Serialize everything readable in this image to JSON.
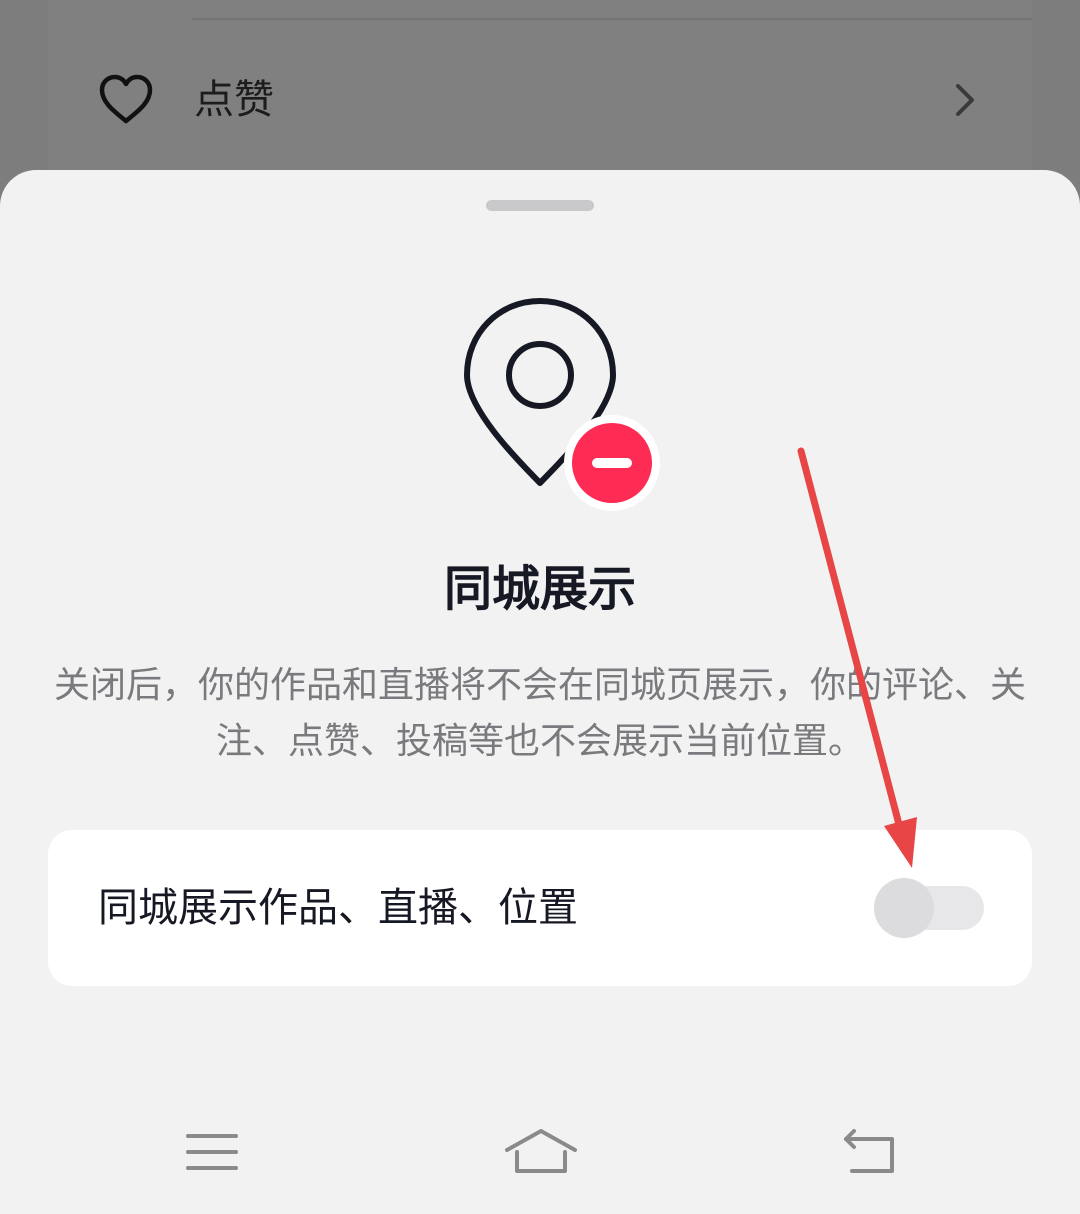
{
  "background": {
    "row_label": "点赞",
    "row_icon": "heart-icon",
    "row_chevron": "chevron-right-icon"
  },
  "sheet": {
    "icon": "location-pin-off-icon",
    "title": "同城展示",
    "description": "关闭后，你的作品和直播将不会在同城页展示，你的评论、关注、点赞、投稿等也不会展示当前位置。",
    "setting": {
      "label": "同城展示作品、直播、位置",
      "enabled": false
    }
  },
  "nav": {
    "icons": [
      "menu-icon",
      "home-icon",
      "back-icon"
    ]
  },
  "colors": {
    "accent_red": "#fe2c55",
    "annotation_red": "#e84646",
    "title_text": "#161823",
    "desc_text": "#7a7a7e"
  }
}
